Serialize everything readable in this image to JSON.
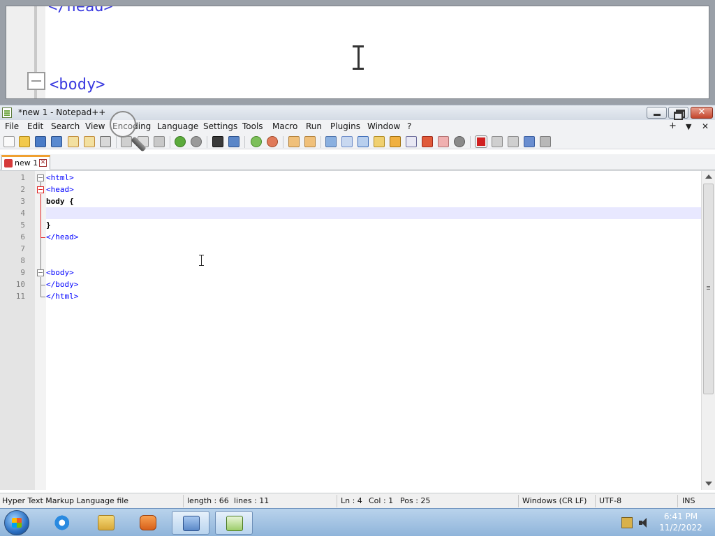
{
  "magnifier": {
    "head_text": "</head>",
    "body_text": "<body>"
  },
  "window": {
    "title": "*new 1 - Notepad++",
    "close_glyph": "✕"
  },
  "menu": {
    "items": [
      "File",
      "Edit",
      "Search",
      "View",
      "Encoding",
      "Language",
      "Settings",
      "Tools",
      "Macro",
      "Run",
      "Plugins",
      "Window",
      "?"
    ],
    "right_plus": "+",
    "right_down": "▼",
    "right_close": "✕"
  },
  "toolbar": {
    "icons": [
      "new-file-icon",
      "open-file-icon",
      "save-icon",
      "save-all-icon",
      "close-icon",
      "close-all-icon",
      "print-icon",
      "cut-icon",
      "copy-icon",
      "paste-icon",
      "undo-icon",
      "redo-icon",
      "find-icon",
      "replace-icon",
      "zoom-in-icon",
      "zoom-out-icon",
      "sync-vertical-icon",
      "sync-horizontal-icon",
      "word-wrap-icon",
      "show-all-chars-icon",
      "indent-guide-icon",
      "doc-map-icon",
      "function-list-icon",
      "doc-list-icon",
      "folder-workspace-icon",
      "monitoring-icon",
      "record-macro-icon",
      "stop-macro-icon",
      "play-macro-icon",
      "run-macro-multiple-icon",
      "save-macro-icon"
    ]
  },
  "tabs": [
    {
      "label": "new 1",
      "close": "✕"
    }
  ],
  "editor": {
    "lines": [
      {
        "num": "1",
        "text": "<html>"
      },
      {
        "num": "2",
        "text": "<head>"
      },
      {
        "num": "3",
        "text": "body {"
      },
      {
        "num": "4",
        "text": ""
      },
      {
        "num": "5",
        "text": "}"
      },
      {
        "num": "6",
        "text": "</head>"
      },
      {
        "num": "7",
        "text": ""
      },
      {
        "num": "8",
        "text": ""
      },
      {
        "num": "9",
        "text": "<body>"
      },
      {
        "num": "10",
        "text": "</body>"
      },
      {
        "num": "11",
        "text": "</html>"
      }
    ]
  },
  "status": {
    "file_type": "Hyper Text Markup Language file",
    "length": "length : 66",
    "lines": "lines : 11",
    "ln": "Ln : 4",
    "col": "Col : 1",
    "pos": "Pos : 25",
    "eol": "Windows (CR LF)",
    "encoding": "UTF-8",
    "mode": "INS"
  },
  "taskbar": {
    "clock_time": "6:41 PM",
    "clock_date": "11/2/2022"
  },
  "colors": {
    "tag_color": "#0000ff",
    "fold_active": "#e02020",
    "current_line": "#e8e8ff"
  }
}
